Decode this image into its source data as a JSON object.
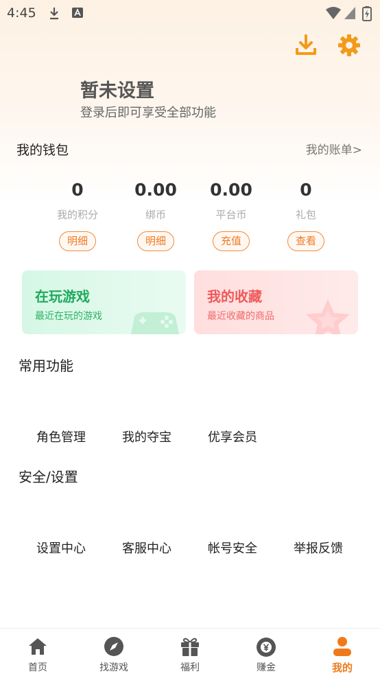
{
  "status_bar": {
    "time": "4:45"
  },
  "colors": {
    "accent": "#f07a1a",
    "green": "#1faa5c",
    "red": "#f05a5a"
  },
  "profile": {
    "name": "暂未设置",
    "subtitle": "登录后即可享受全部功能"
  },
  "wallet": {
    "title": "我的钱包",
    "bill_link": "我的账单>",
    "stats": [
      {
        "value": "0",
        "label": "我的积分",
        "button": "明细"
      },
      {
        "value": "0.00",
        "label": "绑币",
        "button": "明细"
      },
      {
        "value": "0.00",
        "label": "平台币",
        "button": "充值"
      },
      {
        "value": "0",
        "label": "礼包",
        "button": "查看"
      }
    ]
  },
  "cards": [
    {
      "title": "在玩游戏",
      "subtitle": "最近在玩的游戏"
    },
    {
      "title": "我的收藏",
      "subtitle": "最近收藏的商品"
    }
  ],
  "common": {
    "title": "常用功能",
    "items": [
      "角色管理",
      "我的夺宝",
      "优享会员"
    ]
  },
  "security": {
    "title": "安全/设置",
    "items": [
      "设置中心",
      "客服中心",
      "帐号安全",
      "举报反馈"
    ]
  },
  "tabbar": [
    {
      "label": "首页",
      "icon": "home-icon"
    },
    {
      "label": "找游戏",
      "icon": "compass-icon"
    },
    {
      "label": "福利",
      "icon": "gift-icon"
    },
    {
      "label": "赚金",
      "icon": "money-bag-icon"
    },
    {
      "label": "我的",
      "icon": "user-icon",
      "active": true
    }
  ]
}
